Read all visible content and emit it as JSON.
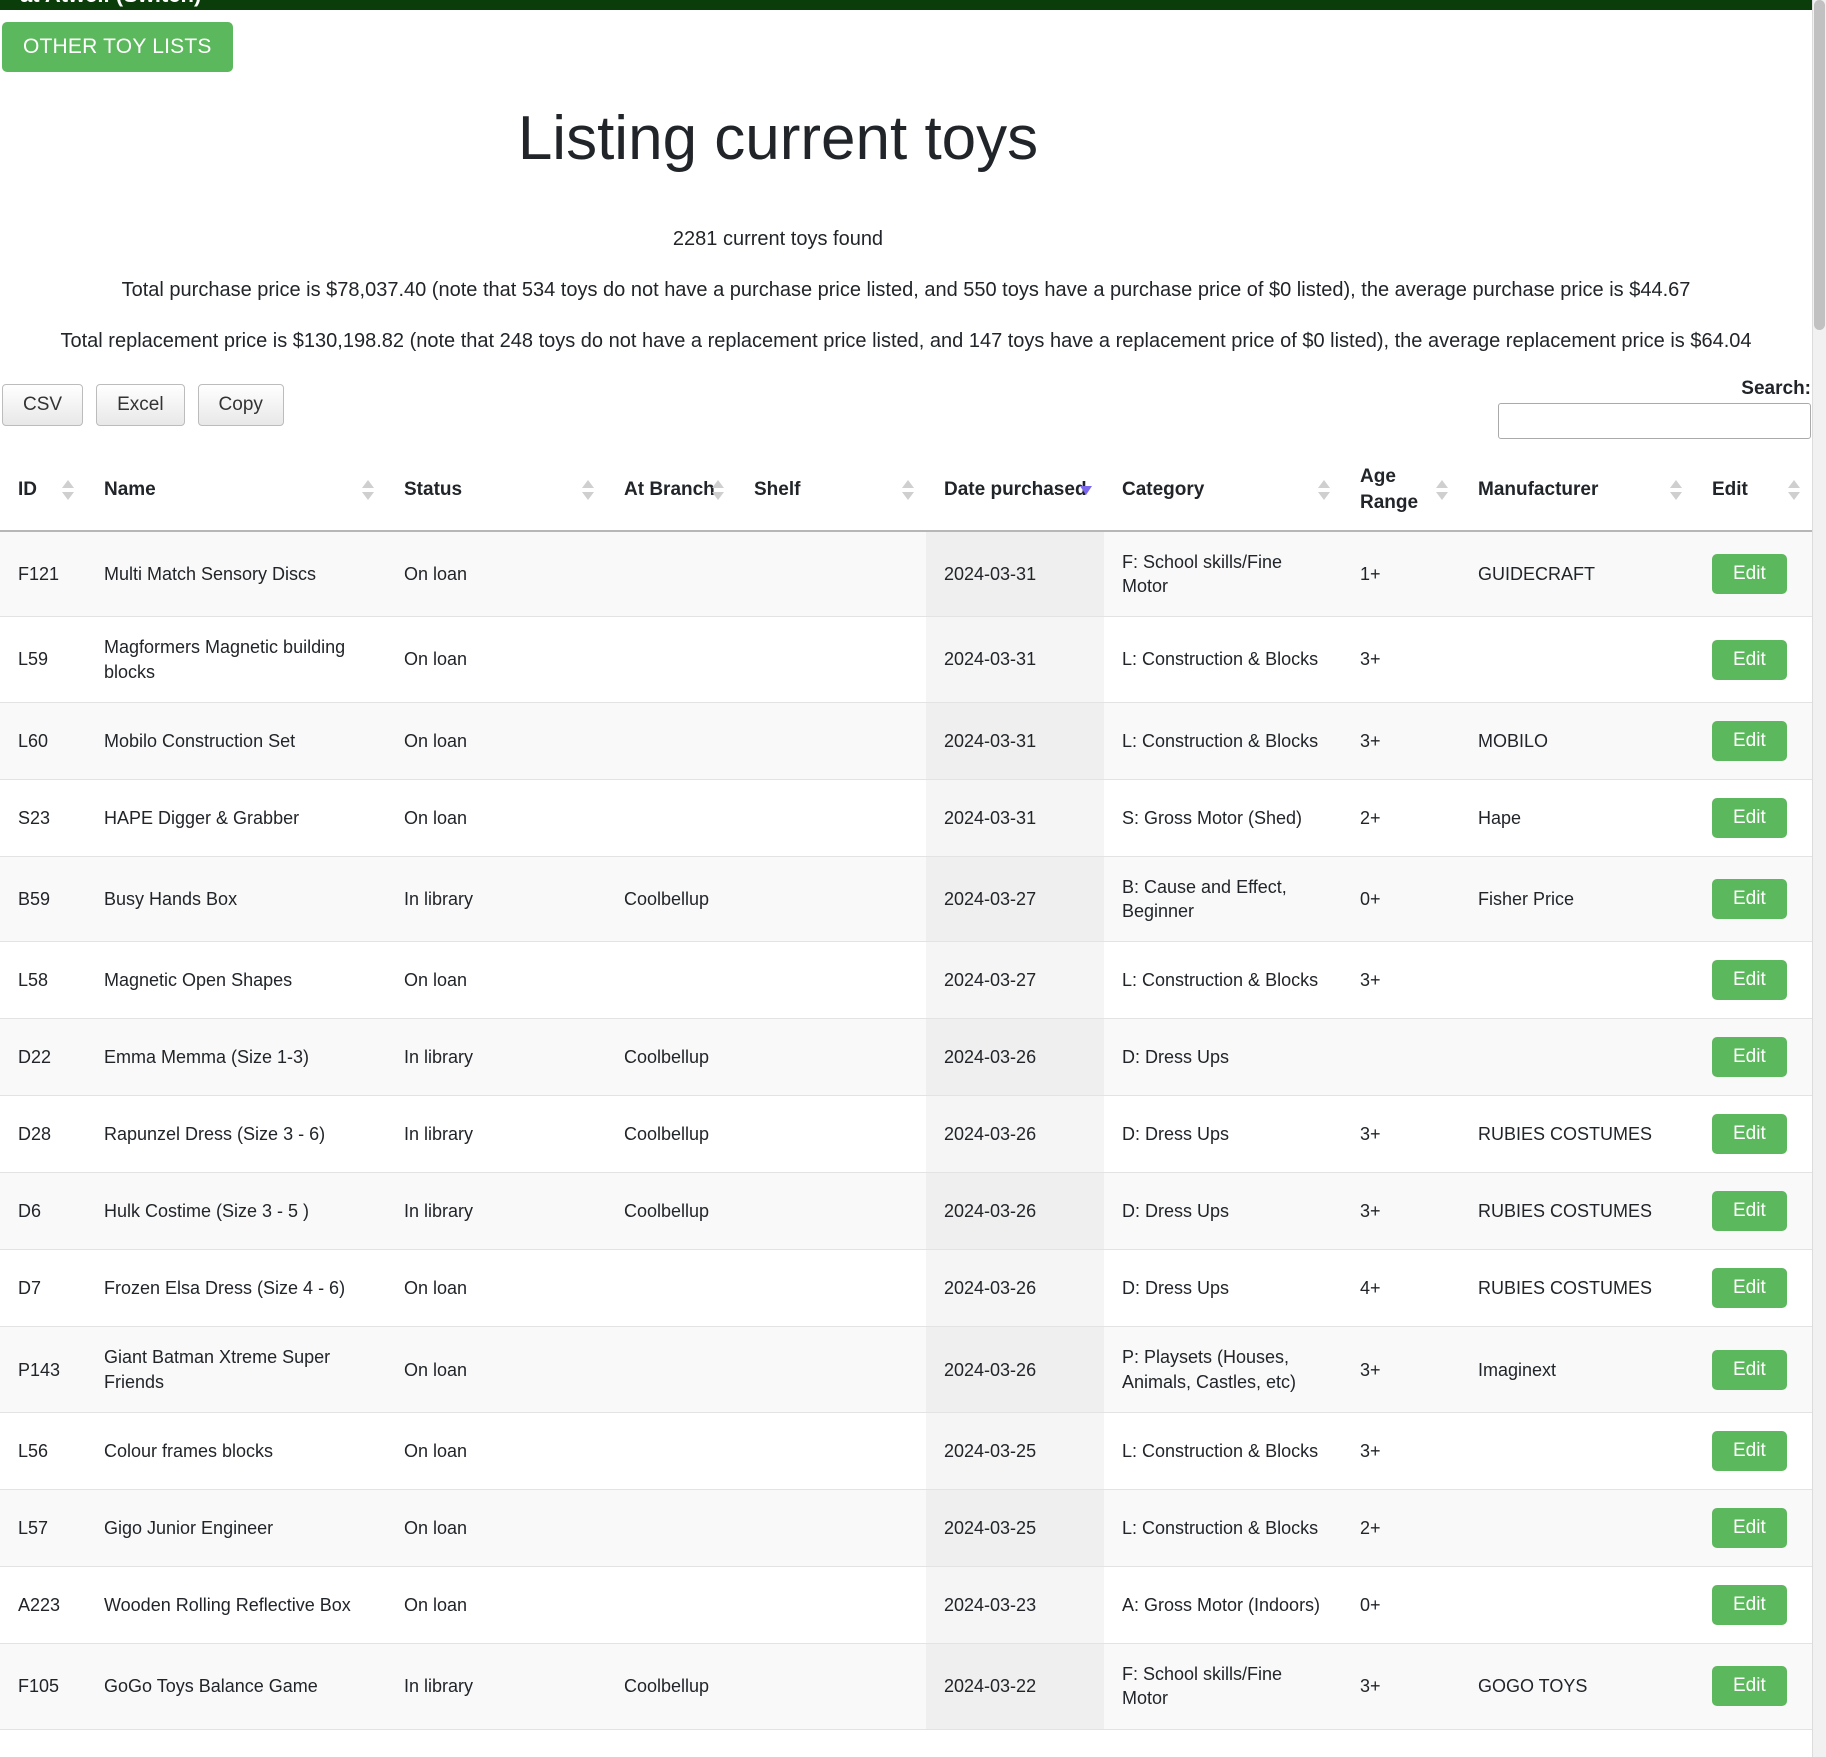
{
  "navbar": {
    "title": "at Atwell (Switch)"
  },
  "toolbar": {
    "other_toy_lists_label": "OTHER TOY LISTS"
  },
  "header": {
    "page_title": "Listing current toys",
    "found_line": "2281 current toys found",
    "purchase_summary": "Total purchase price is $78,037.40 (note that 534 toys do not have a purchase price listed, and 550 toys have a purchase price of $0 listed), the average purchase price is $44.67",
    "replacement_summary": "Total replacement price is $130,198.82 (note that 248 toys do not have a replacement price listed, and 147 toys have a replacement price of $0 listed), the average replacement price is $64.04"
  },
  "export_buttons": [
    {
      "label": "CSV"
    },
    {
      "label": "Excel"
    },
    {
      "label": "Copy"
    }
  ],
  "search": {
    "label": "Search:",
    "value": "",
    "placeholder": ""
  },
  "table": {
    "columns": [
      {
        "label": "ID",
        "sort": "none"
      },
      {
        "label": "Name",
        "sort": "none"
      },
      {
        "label": "Status",
        "sort": "none"
      },
      {
        "label": "At Branch",
        "sort": "none"
      },
      {
        "label": "Shelf",
        "sort": "none"
      },
      {
        "label": "Date purchased",
        "sort": "desc"
      },
      {
        "label": "Category",
        "sort": "none"
      },
      {
        "label": "Age Range",
        "sort": "none"
      },
      {
        "label": "Manufacturer",
        "sort": "none"
      },
      {
        "label": "Edit",
        "sort": "none"
      }
    ],
    "edit_label": "Edit",
    "rows": [
      {
        "id": "F121",
        "name": "Multi Match Sensory Discs",
        "status": "On loan",
        "at_branch": "",
        "shelf": "",
        "date_purchased": "2024-03-31",
        "category": "F: School skills/Fine Motor",
        "age_range": "1+",
        "manufacturer": "GUIDECRAFT"
      },
      {
        "id": "L59",
        "name": "Magformers Magnetic building blocks",
        "status": "On loan",
        "at_branch": "",
        "shelf": "",
        "date_purchased": "2024-03-31",
        "category": "L: Construction & Blocks",
        "age_range": "3+",
        "manufacturer": ""
      },
      {
        "id": "L60",
        "name": "Mobilo Construction Set",
        "status": "On loan",
        "at_branch": "",
        "shelf": "",
        "date_purchased": "2024-03-31",
        "category": "L: Construction & Blocks",
        "age_range": "3+",
        "manufacturer": "MOBILO"
      },
      {
        "id": "S23",
        "name": "HAPE Digger & Grabber",
        "status": "On loan",
        "at_branch": "",
        "shelf": "",
        "date_purchased": "2024-03-31",
        "category": "S: Gross Motor (Shed)",
        "age_range": "2+",
        "manufacturer": "Hape"
      },
      {
        "id": "B59",
        "name": "Busy Hands Box",
        "status": "In library",
        "at_branch": "Coolbellup",
        "shelf": "",
        "date_purchased": "2024-03-27",
        "category": "B: Cause and Effect, Beginner",
        "age_range": "0+",
        "manufacturer": "Fisher Price"
      },
      {
        "id": "L58",
        "name": "Magnetic Open Shapes",
        "status": "On loan",
        "at_branch": "",
        "shelf": "",
        "date_purchased": "2024-03-27",
        "category": "L: Construction & Blocks",
        "age_range": "3+",
        "manufacturer": ""
      },
      {
        "id": "D22",
        "name": "Emma Memma (Size 1-3)",
        "status": "In library",
        "at_branch": "Coolbellup",
        "shelf": "",
        "date_purchased": "2024-03-26",
        "category": "D: Dress Ups",
        "age_range": "",
        "manufacturer": ""
      },
      {
        "id": "D28",
        "name": "Rapunzel Dress (Size 3 - 6)",
        "status": "In library",
        "at_branch": "Coolbellup",
        "shelf": "",
        "date_purchased": "2024-03-26",
        "category": "D: Dress Ups",
        "age_range": "3+",
        "manufacturer": "RUBIES COSTUMES"
      },
      {
        "id": "D6",
        "name": "Hulk Costime (Size 3 - 5 )",
        "status": "In library",
        "at_branch": "Coolbellup",
        "shelf": "",
        "date_purchased": "2024-03-26",
        "category": "D: Dress Ups",
        "age_range": "3+",
        "manufacturer": "RUBIES COSTUMES"
      },
      {
        "id": "D7",
        "name": "Frozen Elsa Dress (Size 4 - 6)",
        "status": "On loan",
        "at_branch": "",
        "shelf": "",
        "date_purchased": "2024-03-26",
        "category": "D: Dress Ups",
        "age_range": "4+",
        "manufacturer": "RUBIES COSTUMES"
      },
      {
        "id": "P143",
        "name": "Giant Batman Xtreme Super Friends",
        "status": "On loan",
        "at_branch": "",
        "shelf": "",
        "date_purchased": "2024-03-26",
        "category": "P: Playsets (Houses, Animals, Castles, etc)",
        "age_range": "3+",
        "manufacturer": "Imaginext"
      },
      {
        "id": "L56",
        "name": "Colour frames blocks",
        "status": "On loan",
        "at_branch": "",
        "shelf": "",
        "date_purchased": "2024-03-25",
        "category": "L: Construction & Blocks",
        "age_range": "3+",
        "manufacturer": ""
      },
      {
        "id": "L57",
        "name": "Gigo Junior Engineer",
        "status": "On loan",
        "at_branch": "",
        "shelf": "",
        "date_purchased": "2024-03-25",
        "category": "L: Construction & Blocks",
        "age_range": "2+",
        "manufacturer": ""
      },
      {
        "id": "A223",
        "name": "Wooden Rolling Reflective Box",
        "status": "On loan",
        "at_branch": "",
        "shelf": "",
        "date_purchased": "2024-03-23",
        "category": "A: Gross Motor (Indoors)",
        "age_range": "0+",
        "manufacturer": ""
      },
      {
        "id": "F105",
        "name": "GoGo Toys Balance Game",
        "status": "In library",
        "at_branch": "Coolbellup",
        "shelf": "",
        "date_purchased": "2024-03-22",
        "category": "F: School skills/Fine Motor",
        "age_range": "3+",
        "manufacturer": "GOGO TOYS"
      }
    ]
  },
  "colors": {
    "brand_green": "#5cb85c",
    "navbar_green": "#0b3d0b",
    "sort_active": "#7b68ee"
  }
}
